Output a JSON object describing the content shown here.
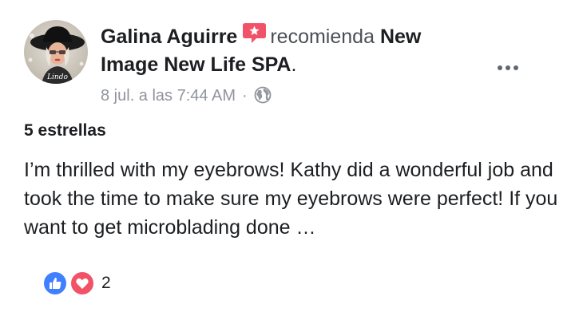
{
  "post": {
    "author": "Galina Aguirre",
    "action": "recomienda",
    "page_name": "New Image New Life SPA",
    "punctuation": ".",
    "timestamp": "8 jul. a las 7:44 AM",
    "separator": "·",
    "avatar_caption": "Lindo",
    "privacy_icon": "globe-icon",
    "more_icon": "more-options-icon",
    "recommend_icon": "recommendation-badge-icon"
  },
  "review": {
    "rating_label": "5 estrellas",
    "text": "I’m thrilled with my eyebrows! Kathy did a wonderful job and took the time to make sure my eyebrows were perfect! If you want to get microblading done …"
  },
  "reactions": {
    "types": [
      "like",
      "love"
    ],
    "count": "2"
  },
  "colors": {
    "text_primary": "#1c1e21",
    "text_secondary": "#4b4f56",
    "meta": "#90949c",
    "badge": "#f25268",
    "like": "#4080ff",
    "love": "#f25268"
  }
}
